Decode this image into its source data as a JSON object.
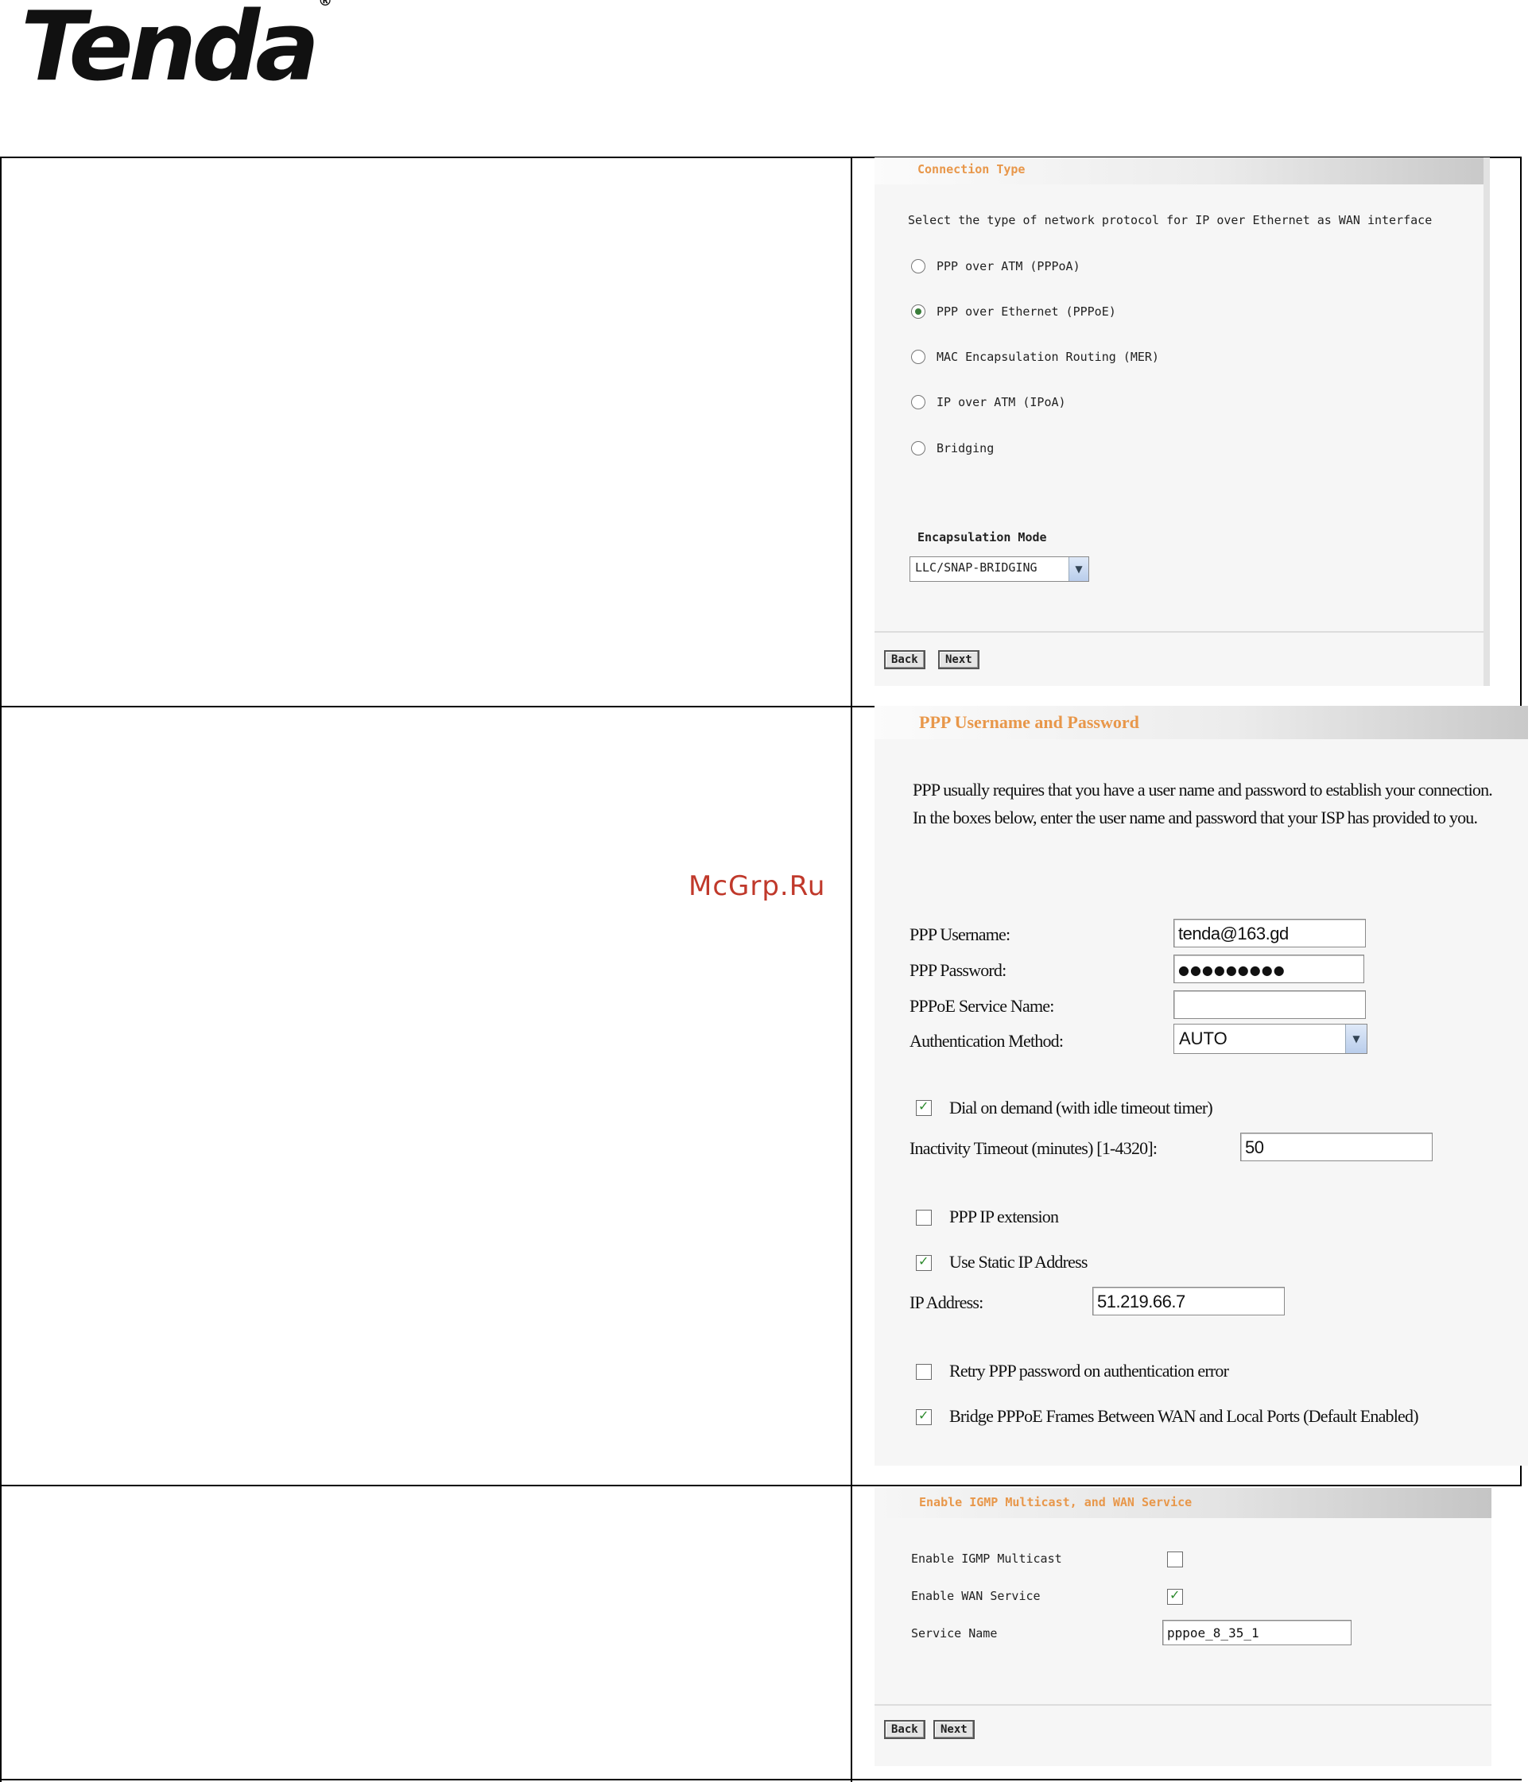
{
  "brand": {
    "logo_text": "Tenda",
    "registered_mark": "®"
  },
  "watermark": "McGrp.Ru",
  "connection_type": {
    "title": "Connection Type",
    "intro": "Select the type of network protocol for IP over Ethernet as WAN interface",
    "options": [
      {
        "label": "PPP over ATM (PPPoA)",
        "selected": false
      },
      {
        "label": "PPP over Ethernet (PPPoE)",
        "selected": true
      },
      {
        "label": "MAC Encapsulation Routing (MER)",
        "selected": false
      },
      {
        "label": "IP over ATM (IPoA)",
        "selected": false
      },
      {
        "label": "Bridging",
        "selected": false
      }
    ],
    "encapsulation_label": "Encapsulation Mode",
    "encapsulation_value": "LLC/SNAP-BRIDGING",
    "back_label": "Back",
    "next_label": "Next"
  },
  "ppp": {
    "title": "PPP Username and Password",
    "description": "PPP usually requires that you have a user name and password to establish your connection. In the boxes below, enter the user name and password that your ISP has provided to you.",
    "username_label": "PPP Username:",
    "username_value": "tenda@163.gd",
    "password_label": "PPP Password:",
    "password_value": "●●●●●●●●●",
    "service_name_label": "PPPoE Service Name:",
    "service_name_value": "",
    "auth_label": "Authentication Method:",
    "auth_value": "AUTO",
    "dial_on_demand_label": "Dial on demand (with idle timeout timer)",
    "dial_on_demand_checked": true,
    "inactivity_label": "Inactivity Timeout (minutes) [1-4320]:",
    "inactivity_value": "50",
    "ip_extension_label": "PPP IP extension",
    "ip_extension_checked": false,
    "static_ip_label": "Use Static IP Address",
    "static_ip_checked": true,
    "ip_address_label": "IP Address:",
    "ip_address_value": "51.219.66.7",
    "retry_label": "Retry PPP password on authentication error",
    "retry_checked": false,
    "bridge_label": "Bridge PPPoE Frames Between WAN and Local Ports (Default Enabled)",
    "bridge_checked": true
  },
  "services": {
    "title": "Enable IGMP Multicast, and WAN Service",
    "igmp_label": "Enable IGMP Multicast",
    "igmp_checked": false,
    "wan_label": "Enable WAN Service",
    "wan_checked": true,
    "service_name_label": "Service Name",
    "service_name_value": "pppoe_8_35_1",
    "back_label": "Back",
    "next_label": "Next"
  }
}
